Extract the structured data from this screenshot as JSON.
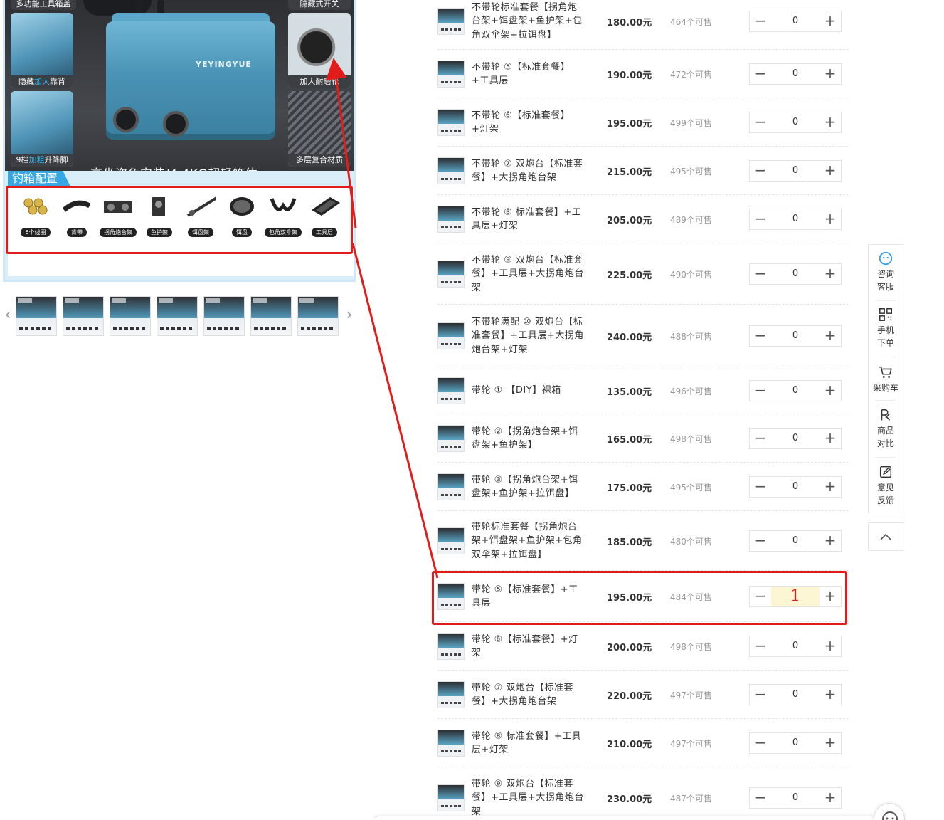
{
  "product_image": {
    "top_left_caption": "多功能工具箱盖",
    "top_right_caption": "隐藏式开关",
    "left_cards": [
      {
        "caption_pre": "隐藏",
        "caption_hl": "加大",
        "caption_post": "靠背"
      },
      {
        "caption_pre": "9档",
        "caption_hl": "加粗",
        "caption_post": "升降脚"
      }
    ],
    "right_cards": [
      {
        "caption": "加大耐磨轮"
      },
      {
        "caption": "多层复合材质"
      }
    ],
    "brand": "YEYINGYUE",
    "slogan": "高坐姿免安装/4.4KG超轻箱体",
    "config_title": "钓箱配置",
    "config_items": [
      "6个线圈",
      "背带",
      "拐角炮台架",
      "鱼护架",
      "饵盘架",
      "饵盘",
      "包角双伞架",
      "工具层"
    ]
  },
  "thumbnails": {
    "prev_label": "‹",
    "next_label": "›",
    "count": 7
  },
  "sku_list": [
    {
      "name": "不带轮标准套餐【拐角炮台架+饵盘架+鱼护架+包角双伞架+拉饵盘】",
      "price": "180.00元",
      "stock": "464个可售",
      "qty": "0"
    },
    {
      "name": "不带轮 ⑤【标准套餐】+工具层",
      "price": "190.00元",
      "stock": "472个可售",
      "qty": "0"
    },
    {
      "name": "不带轮 ⑥【标准套餐】+灯架",
      "price": "195.00元",
      "stock": "499个可售",
      "qty": "0"
    },
    {
      "name": "不带轮 ⑦ 双炮台【标准套餐】+大拐角炮台架",
      "price": "215.00元",
      "stock": "495个可售",
      "qty": "0"
    },
    {
      "name": "不带轮 ⑧ 标准套餐】+工具层+灯架",
      "price": "205.00元",
      "stock": "489个可售",
      "qty": "0"
    },
    {
      "name": "不带轮 ⑨ 双炮台【标准套餐】+工具层+大拐角炮台架",
      "price": "225.00元",
      "stock": "490个可售",
      "qty": "0"
    },
    {
      "name": "不带轮满配 ⑩ 双炮台【标准套餐】+工具层+大拐角炮台架+灯架",
      "price": "240.00元",
      "stock": "488个可售",
      "qty": "0"
    },
    {
      "name": "带轮 ① 【DIY】裸箱",
      "price": "135.00元",
      "stock": "496个可售",
      "qty": "0"
    },
    {
      "name": "带轮 ②【拐角炮台架+饵盘架+鱼护架】",
      "price": "165.00元",
      "stock": "498个可售",
      "qty": "0"
    },
    {
      "name": "带轮 ③【拐角炮台架+饵盘架+鱼护架+拉饵盘】",
      "price": "175.00元",
      "stock": "495个可售",
      "qty": "0"
    },
    {
      "name": "带轮标准套餐【拐角炮台架+饵盘架+鱼护架+包角双伞架+拉饵盘】",
      "price": "185.00元",
      "stock": "480个可售",
      "qty": "0"
    },
    {
      "name": "带轮 ⑤【标准套餐】+工具层",
      "price": "195.00元",
      "stock": "484个可售",
      "qty": "1"
    },
    {
      "name": "带轮 ⑥【标准套餐】+灯架",
      "price": "200.00元",
      "stock": "498个可售",
      "qty": "0"
    },
    {
      "name": "带轮 ⑦ 双炮台【标准套餐】+大拐角炮台架",
      "price": "220.00元",
      "stock": "497个可售",
      "qty": "0"
    },
    {
      "name": "带轮 ⑧ 标准套餐】+工具层+灯架",
      "price": "210.00元",
      "stock": "497个可售",
      "qty": "0"
    },
    {
      "name": "带轮 ⑨ 双炮台【标准套餐】+工具层+大拐角炮台架",
      "price": "230.00元",
      "stock": "487个可售",
      "qty": "0"
    }
  ],
  "stepper": {
    "minus": "−",
    "plus": "+"
  },
  "side_tools": {
    "consult": "咨询客服",
    "mobile": "手机下单",
    "cart": "采购车",
    "compare": "商品对比",
    "feedback": "意见反馈"
  },
  "colors": {
    "annotation": "#e21b1b",
    "accent": "#35a7e4",
    "highlight_qty_bg": "#fdf6d4"
  }
}
